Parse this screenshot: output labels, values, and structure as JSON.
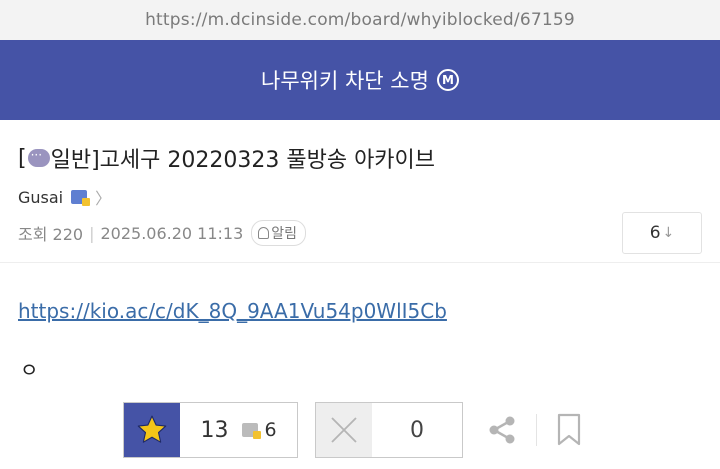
{
  "browser": {
    "url": "https://m.dcinside.com/board/whyiblocked/67159"
  },
  "gallery": {
    "title": "나무위키 차단 소명",
    "badge": "M"
  },
  "post": {
    "title_prefix": "[",
    "title_head": "일반]",
    "title_text": " 고세구 20220323 풀방송 아카이브",
    "author": "Gusai",
    "views_label": "조회 220",
    "date": "2025.06.20 11:13",
    "alarm_label": "알림",
    "reply_count": "6",
    "reply_arrow": "↓",
    "link": "https://kio.ac/c/dK_8Q_9AA1Vu54p0WlI5Cb",
    "body_text": "ㅇ"
  },
  "actions": {
    "recommend_count": "13",
    "fix_recommend_count": "6",
    "nonrecommend_count": "0"
  },
  "colors": {
    "brand": "#4553a6",
    "star": "#f5c518",
    "link": "#3a6ca8"
  }
}
